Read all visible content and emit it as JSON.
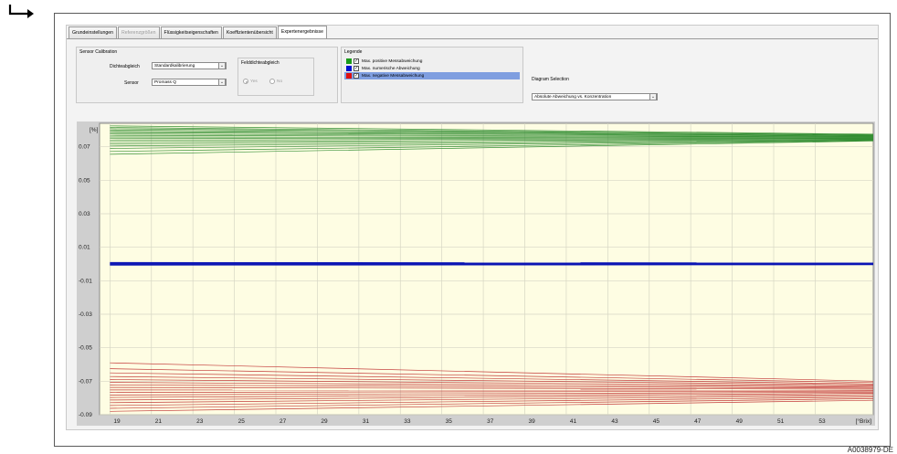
{
  "tabs": [
    {
      "label": "Grundeinstellungen",
      "state": "normal"
    },
    {
      "label": "Referenzgrößen",
      "state": "disabled"
    },
    {
      "label": "Flüssigkeitseigenschaften",
      "state": "normal"
    },
    {
      "label": "Koeffizientenübersicht",
      "state": "normal"
    },
    {
      "label": "Expertenergebnisse",
      "state": "active"
    }
  ],
  "sensor_calibration": {
    "title": "Sensor Calibration",
    "dichteabgleich_label": "Dichteabgleich",
    "dichteabgleich_value": "Standardkalibrierung",
    "sensor_label": "Sensor",
    "sensor_value": "Promass Q",
    "feld_title": "Felddichteabgleich",
    "radio_yes": "Yes",
    "radio_no": "No",
    "radio_selected": "Yes"
  },
  "legend": {
    "title": "Legende",
    "items": [
      {
        "label": "Max. positive Messabweichung",
        "color": "#1a9b1a",
        "checked": true,
        "selected": false
      },
      {
        "label": "Max. numerische Abweichung",
        "color": "#0010d0",
        "checked": true,
        "selected": false
      },
      {
        "label": "Max. negative Messabweichung",
        "color": "#e01010",
        "checked": true,
        "selected": true
      }
    ]
  },
  "diagram_selection": {
    "label": "Diagram Selection",
    "value": "Absolute Abweichung vs. Konzentration"
  },
  "chart_data": {
    "type": "line",
    "ylabel_unit": "[%]",
    "xlabel_unit": "[°Brix]",
    "xlim": [
      18.5,
      55.8
    ],
    "ylim": [
      -0.09,
      0.084
    ],
    "x_ticks": [
      19,
      21,
      23,
      25,
      27,
      29,
      31,
      33,
      35,
      37,
      39,
      41,
      43,
      45,
      47,
      49,
      51,
      53
    ],
    "y_ticks": [
      0.07,
      0.05,
      0.03,
      0.01,
      -0.01,
      -0.03,
      -0.05,
      -0.07,
      -0.09
    ],
    "y_tick_labels": [
      "0.07",
      "0.05",
      "0.03",
      "0.01",
      "-0.01",
      "-0.03",
      "-0.05",
      "-0.07",
      "-0.09"
    ],
    "background": "#fefde3",
    "grid": true,
    "series": [
      {
        "name": "Max. positive Messabweichung",
        "color": "#2e8b2e",
        "lines": [
          {
            "x": [
              19,
              55.8
            ],
            "y": [
              0.0825,
              0.0775
            ]
          },
          {
            "x": [
              19,
              55.8
            ],
            "y": [
              0.0815,
              0.0772
            ]
          },
          {
            "x": [
              19,
              55.8
            ],
            "y": [
              0.0808,
              0.077
            ]
          },
          {
            "x": [
              19,
              55.8
            ],
            "y": [
              0.08,
              0.0767
            ]
          },
          {
            "x": [
              19,
              55.8
            ],
            "y": [
              0.0792,
              0.0765
            ]
          },
          {
            "x": [
              19,
              55.8
            ],
            "y": [
              0.0785,
              0.0762
            ]
          },
          {
            "x": [
              19,
              55.8
            ],
            "y": [
              0.0776,
              0.0759
            ]
          },
          {
            "x": [
              19,
              55.8
            ],
            "y": [
              0.0768,
              0.0757
            ]
          },
          {
            "x": [
              19,
              55.8
            ],
            "y": [
              0.0758,
              0.0754
            ]
          },
          {
            "x": [
              19,
              55.8
            ],
            "y": [
              0.0749,
              0.0751
            ]
          },
          {
            "x": [
              19,
              55.8
            ],
            "y": [
              0.074,
              0.0749
            ]
          },
          {
            "x": [
              19,
              55.8
            ],
            "y": [
              0.073,
              0.0746
            ]
          },
          {
            "x": [
              19,
              55.8
            ],
            "y": [
              0.0718,
              0.0744
            ]
          },
          {
            "x": [
              19,
              55.8
            ],
            "y": [
              0.0705,
              0.0741
            ]
          },
          {
            "x": [
              19,
              55.8
            ],
            "y": [
              0.069,
              0.0739
            ]
          },
          {
            "x": [
              19,
              55.8
            ],
            "y": [
              0.0672,
              0.0737
            ]
          },
          {
            "x": [
              19,
              55.8
            ],
            "y": [
              0.0655,
              0.0735
            ]
          }
        ]
      },
      {
        "name": "Max. numerische Abweichung",
        "color": "#0a14b4",
        "lines": [
          {
            "x": [
              19,
              55.8
            ],
            "y": [
              0.0008,
              0.0006
            ]
          },
          {
            "x": [
              19,
              55.8
            ],
            "y": [
              0.0004,
              0.0003
            ]
          },
          {
            "x": [
              19,
              55.8
            ],
            "y": [
              0.0001,
              0.0001
            ]
          },
          {
            "x": [
              19,
              55.8
            ],
            "y": [
              -0.0003,
              -0.0002
            ]
          },
          {
            "x": [
              19,
              55.8
            ],
            "y": [
              -0.0006,
              -0.0004
            ]
          }
        ]
      },
      {
        "name": "Max. negative Messabweichung",
        "color": "#c03030",
        "lines": [
          {
            "x": [
              19,
              55.8
            ],
            "y": [
              -0.059,
              -0.07
            ]
          },
          {
            "x": [
              19,
              55.8
            ],
            "y": [
              -0.0625,
              -0.0708
            ]
          },
          {
            "x": [
              19,
              55.8
            ],
            "y": [
              -0.065,
              -0.0716
            ]
          },
          {
            "x": [
              19,
              55.8
            ],
            "y": [
              -0.0672,
              -0.0722
            ]
          },
          {
            "x": [
              19,
              55.8
            ],
            "y": [
              -0.069,
              -0.0729
            ]
          },
          {
            "x": [
              19,
              55.8
            ],
            "y": [
              -0.0707,
              -0.0735
            ]
          },
          {
            "x": [
              19,
              55.8
            ],
            "y": [
              -0.0722,
              -0.0741
            ]
          },
          {
            "x": [
              19,
              55.8
            ],
            "y": [
              -0.0737,
              -0.0747
            ]
          },
          {
            "x": [
              19,
              55.8
            ],
            "y": [
              -0.0752,
              -0.0753
            ]
          },
          {
            "x": [
              19,
              55.8
            ],
            "y": [
              -0.0767,
              -0.0759
            ]
          },
          {
            "x": [
              19,
              55.8
            ],
            "y": [
              -0.0782,
              -0.0765
            ]
          },
          {
            "x": [
              19,
              55.8
            ],
            "y": [
              -0.0797,
              -0.0772
            ]
          },
          {
            "x": [
              19,
              55.8
            ],
            "y": [
              -0.0812,
              -0.0779
            ]
          },
          {
            "x": [
              19,
              55.8
            ],
            "y": [
              -0.0828,
              -0.0787
            ]
          },
          {
            "x": [
              19,
              55.8
            ],
            "y": [
              -0.0845,
              -0.0795
            ]
          },
          {
            "x": [
              19,
              55.8
            ],
            "y": [
              -0.0862,
              -0.0804
            ]
          },
          {
            "x": [
              19,
              55.8
            ],
            "y": [
              -0.088,
              -0.0814
            ]
          }
        ]
      }
    ]
  },
  "footnote": "A0038979-DE"
}
